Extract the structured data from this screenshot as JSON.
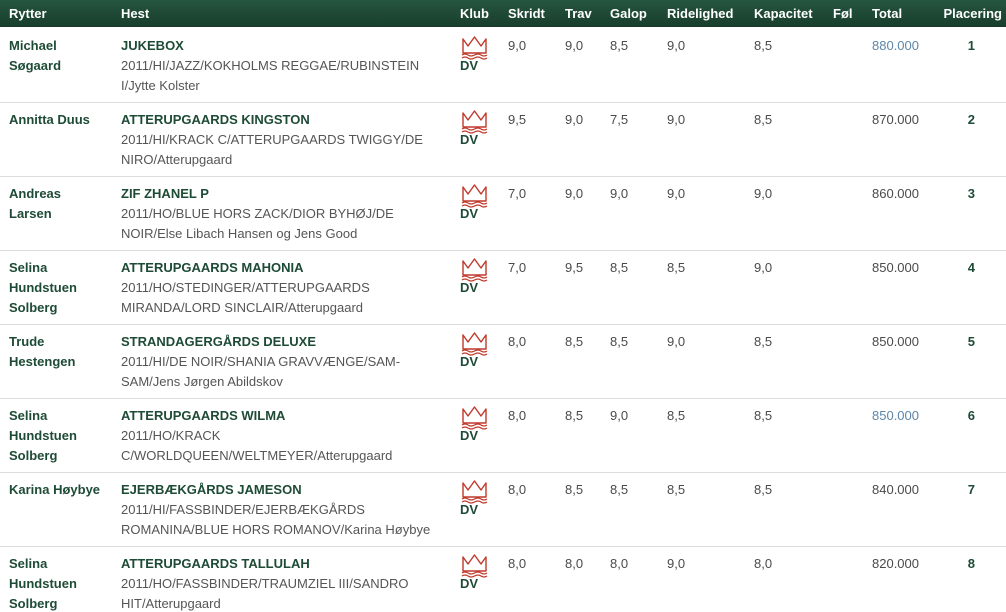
{
  "headers": {
    "rytter": "Rytter",
    "hest": "Hest",
    "klub": "Klub",
    "skridt": "Skridt",
    "trav": "Trav",
    "galop": "Galop",
    "ridelighed": "Ridelighed",
    "kapacitet": "Kapacitet",
    "fol": "Føl",
    "total": "Total",
    "placering": "Placering"
  },
  "colors": {
    "header_bg": "#1f4a36",
    "accent_green": "#1e4b36",
    "crown_red": "#c0392b",
    "link_blue": "#5d86a8"
  },
  "rows": [
    {
      "rider": [
        "Michael",
        "Søgaard"
      ],
      "horse_name": "JUKEBOX",
      "horse_pedigree": "2011/HI/JAZZ/KOKHOLMS REGGAE/RUBINSTEIN I/Jytte Kolster",
      "club_icon": "crown-icon",
      "club": "DV",
      "skridt": "9,0",
      "trav": "9,0",
      "galop": "8,5",
      "ridelighed": "9,0",
      "kapacitet": "8,5",
      "fol": "",
      "total": "880.000",
      "total_is_link": true,
      "placering": "1"
    },
    {
      "rider": [
        "Annitta Duus"
      ],
      "horse_name": "ATTERUPGAARDS KINGSTON",
      "horse_pedigree": "2011/HI/KRACK C/ATTERUPGAARDS TWIGGY/DE NIRO/Atterupgaard",
      "club_icon": "crown-icon",
      "club": "DV",
      "skridt": "9,5",
      "trav": "9,0",
      "galop": "7,5",
      "ridelighed": "9,0",
      "kapacitet": "8,5",
      "fol": "",
      "total": "870.000",
      "total_is_link": false,
      "placering": "2"
    },
    {
      "rider": [
        "Andreas",
        "Larsen"
      ],
      "horse_name": "ZIF ZHANEL P",
      "horse_pedigree": "2011/HO/BLUE HORS ZACK/DIOR BYHØJ/DE NOIR/Else Libach Hansen og Jens Good",
      "club_icon": "crown-icon",
      "club": "DV",
      "skridt": "7,0",
      "trav": "9,0",
      "galop": "9,0",
      "ridelighed": "9,0",
      "kapacitet": "9,0",
      "fol": "",
      "total": "860.000",
      "total_is_link": false,
      "placering": "3"
    },
    {
      "rider": [
        "Selina",
        "Hundstuen",
        "Solberg"
      ],
      "horse_name": "ATTERUPGAARDS MAHONIA",
      "horse_pedigree": "2011/HO/STEDINGER/ATTERUPGAARDS MIRANDA/LORD SINCLAIR/Atterupgaard",
      "club_icon": "crown-icon",
      "club": "DV",
      "skridt": "7,0",
      "trav": "9,5",
      "galop": "8,5",
      "ridelighed": "8,5",
      "kapacitet": "9,0",
      "fol": "",
      "total": "850.000",
      "total_is_link": false,
      "placering": "4"
    },
    {
      "rider": [
        "Trude",
        "Hestengen"
      ],
      "horse_name": "STRANDAGERGÅRDS DELUXE",
      "horse_pedigree": "2011/HI/DE NOIR/SHANIA GRAVVÆNGE/SAM-SAM/Jens Jørgen Abildskov",
      "club_icon": "crown-icon",
      "club": "DV",
      "skridt": "8,0",
      "trav": "8,5",
      "galop": "8,5",
      "ridelighed": "9,0",
      "kapacitet": "8,5",
      "fol": "",
      "total": "850.000",
      "total_is_link": false,
      "placering": "5"
    },
    {
      "rider": [
        "Selina",
        "Hundstuen",
        "Solberg"
      ],
      "horse_name": "ATTERUPGAARDS WILMA",
      "horse_pedigree": "2011/HO/KRACK C/WORLDQUEEN/WELTMEYER/Atterupgaard",
      "club_icon": "crown-icon",
      "club": "DV",
      "skridt": "8,0",
      "trav": "8,5",
      "galop": "9,0",
      "ridelighed": "8,5",
      "kapacitet": "8,5",
      "fol": "",
      "total": "850.000",
      "total_is_link": true,
      "placering": "6"
    },
    {
      "rider": [
        "Karina Høybye"
      ],
      "horse_name": "EJERBÆKGÅRDS JAMESON",
      "horse_pedigree": "2011/HI/FASSBINDER/EJERBÆKGÅRDS ROMANINA/BLUE HORS ROMANOV/Karina Høybye",
      "club_icon": "crown-icon",
      "club": "DV",
      "skridt": "8,0",
      "trav": "8,5",
      "galop": "8,5",
      "ridelighed": "8,5",
      "kapacitet": "8,5",
      "fol": "",
      "total": "840.000",
      "total_is_link": false,
      "placering": "7"
    },
    {
      "rider": [
        "Selina",
        "Hundstuen",
        "Solberg"
      ],
      "horse_name": "ATTERUPGAARDS TALLULAH",
      "horse_pedigree": "2011/HO/FASSBINDER/TRAUMZIEL III/SANDRO HIT/Atterupgaard",
      "club_icon": "crown-icon",
      "club": "DV",
      "skridt": "8,0",
      "trav": "8,0",
      "galop": "8,0",
      "ridelighed": "9,0",
      "kapacitet": "8,0",
      "fol": "",
      "total": "820.000",
      "total_is_link": false,
      "placering": "8"
    }
  ]
}
